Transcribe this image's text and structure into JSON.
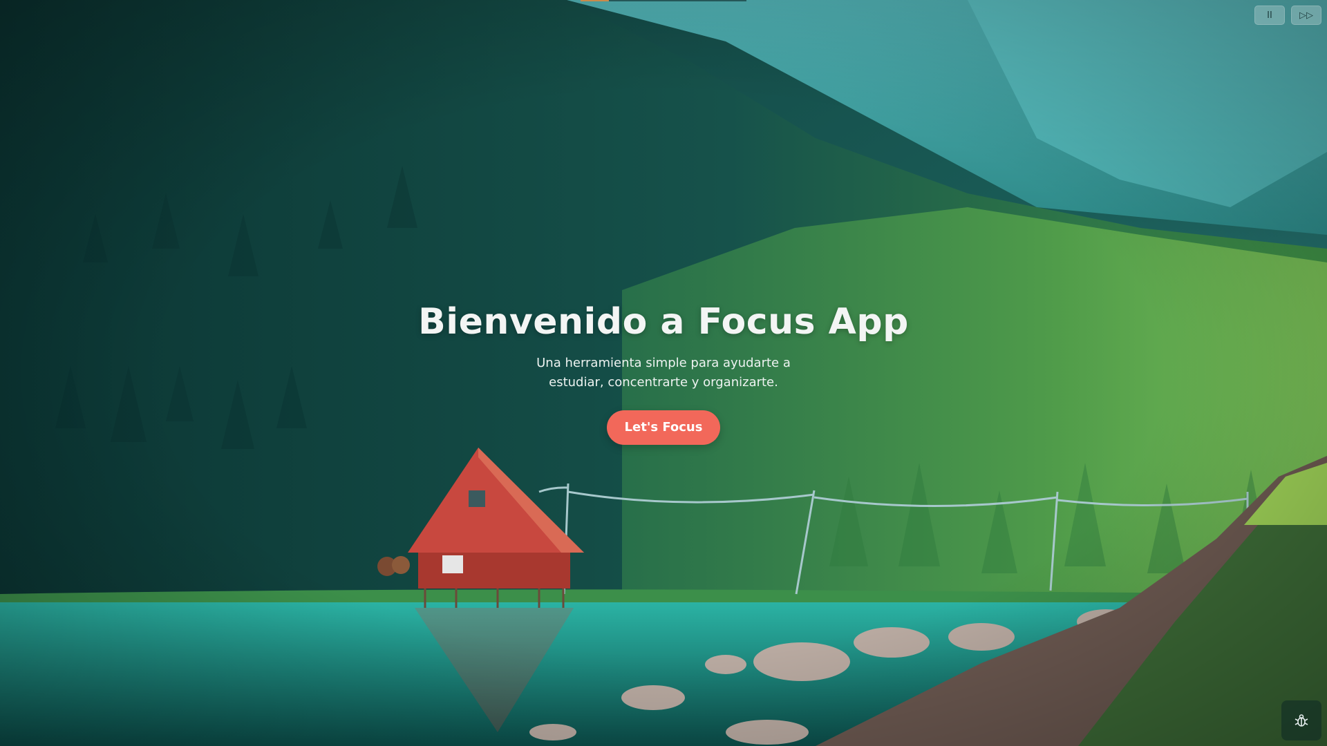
{
  "hero": {
    "title": "Bienvenido a Focus App",
    "subtitle": "Una herramienta simple para ayudarte a estudiar, concentrarte y organizarte.",
    "cta_label": "Let's Focus"
  },
  "media_controls": {
    "pause_icon": "pause-icon",
    "skip_icon": "fast-forward-icon",
    "pause_glyph": "II",
    "skip_glyph": "▷▷"
  },
  "debug_button": {
    "icon": "bug-icon"
  },
  "playback": {
    "progress_fraction": 0.17
  },
  "colors": {
    "cta_background": "#f2685a",
    "hero_text": "#f3f5f4",
    "forest_dark": "#0f3b3a",
    "lake": "#2bb3a4",
    "cabin_roof": "#c8483f"
  }
}
